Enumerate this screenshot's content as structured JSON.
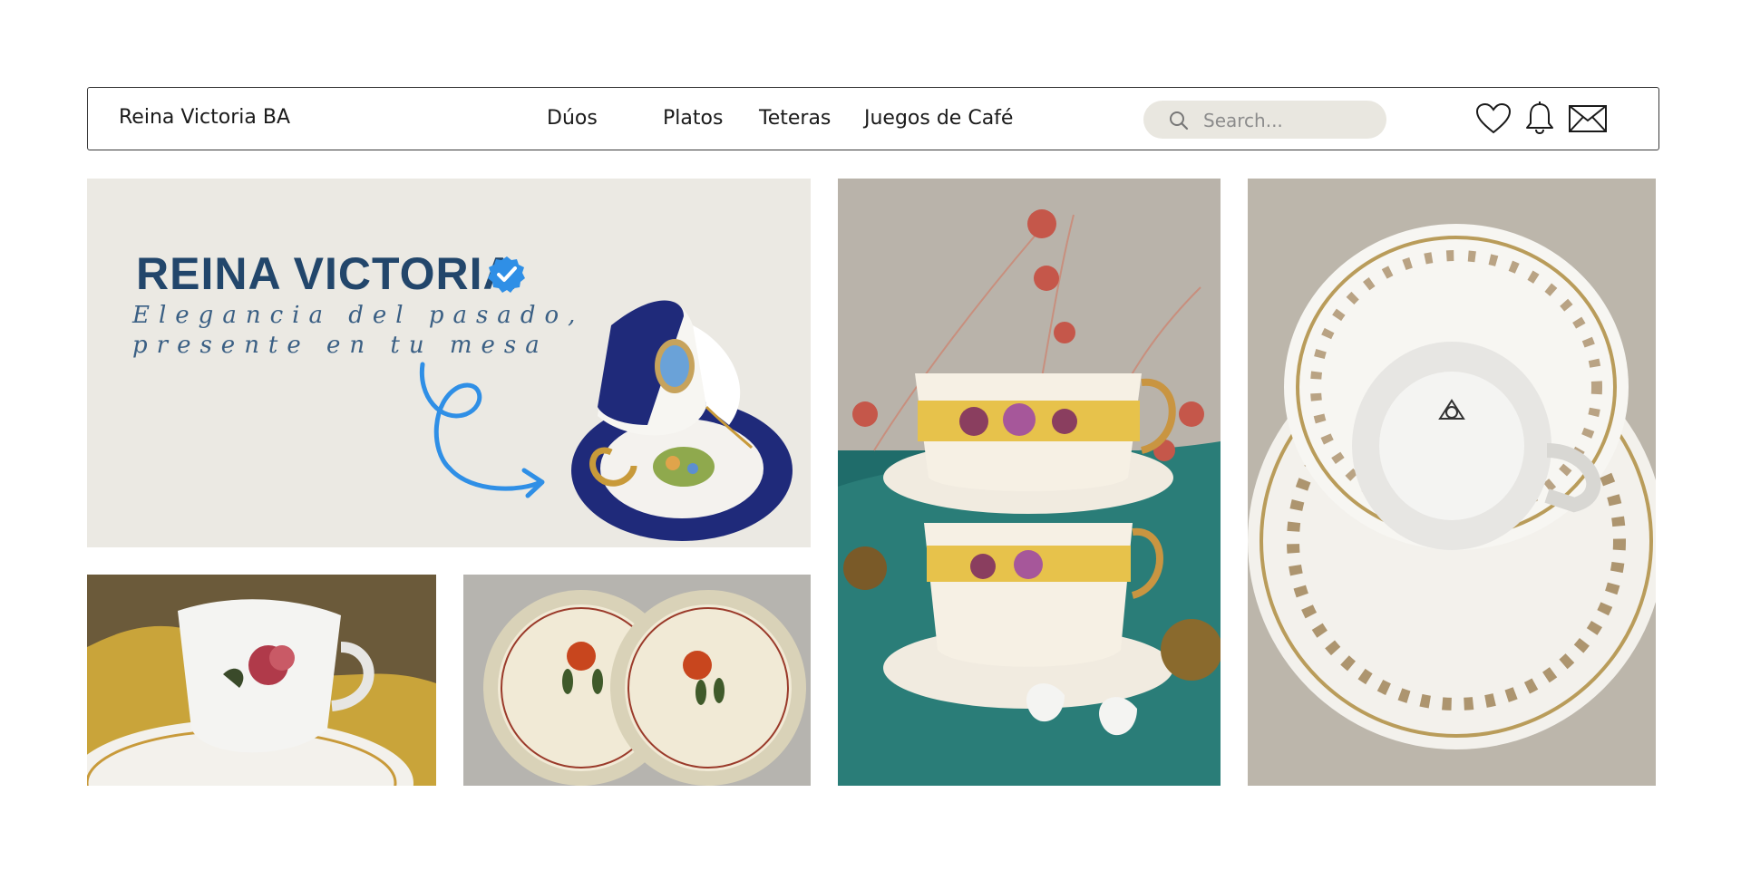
{
  "brand": "Reina Victoria BA",
  "nav": {
    "items": [
      {
        "label": "Dúos"
      },
      {
        "label": "Platos"
      },
      {
        "label": "Teteras"
      },
      {
        "label": "Juegos de Café"
      }
    ]
  },
  "search": {
    "placeholder": "Search..."
  },
  "icons": [
    "heart-icon",
    "bell-icon",
    "mail-icon",
    "search-icon",
    "verified-icon"
  ],
  "hero": {
    "title": "REINA VICTORIA",
    "tagline_line1": "Elegancia del pasado,",
    "tagline_line2": "presente en tu mesa"
  },
  "colors": {
    "title": "#22466b",
    "accent_blue": "#2f8fe6",
    "search_bg": "#e9e7e0",
    "hero_bg": "#ebe9e3"
  }
}
